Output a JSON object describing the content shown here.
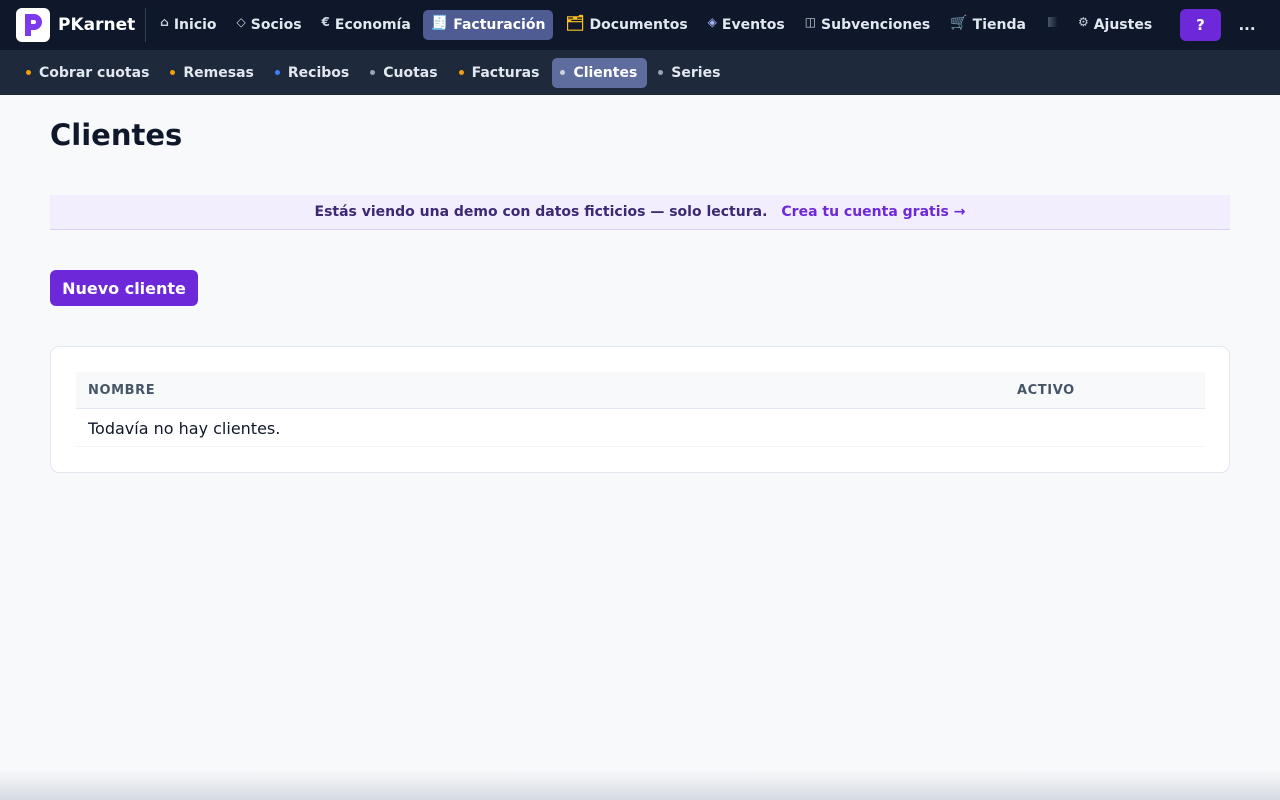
{
  "app": {
    "brand": "PKarnet",
    "logo_letter": "P",
    "accent_color": "#6d28d9"
  },
  "topnav": {
    "items": [
      {
        "label": "Inicio",
        "icon": "home-icon",
        "glyph": "⌂",
        "active": false
      },
      {
        "label": "Socios",
        "icon": "diamond-outline-icon",
        "glyph": "◇",
        "active": false
      },
      {
        "label": "Economía",
        "icon": "euro-icon",
        "glyph": "€",
        "active": false
      },
      {
        "label": "Facturación",
        "icon": "receipt-icon",
        "glyph": "🧾",
        "active": true
      },
      {
        "label": "Documentos",
        "icon": "folder-icon",
        "glyph": "🗂",
        "active": false
      },
      {
        "label": "Eventos",
        "icon": "diamond-icon",
        "glyph": "◈",
        "active": false
      },
      {
        "label": "Subvenciones",
        "icon": "grant-icon",
        "glyph": "◫",
        "active": false
      },
      {
        "label": "Tienda",
        "icon": "cart-icon",
        "glyph": "🛒",
        "active": false
      }
    ],
    "settings": {
      "label": "Ajustes",
      "icon": "gear-icon",
      "glyph": "⚙"
    },
    "help_label": "?",
    "more_label": "..."
  },
  "subnav": {
    "items": [
      {
        "label": "Cobrar cuotas",
        "dot_color": "#f59e0b",
        "active": false
      },
      {
        "label": "Remesas",
        "dot_color": "#f59e0b",
        "active": false
      },
      {
        "label": "Recibos",
        "dot_color": "#3b82f6",
        "active": false
      },
      {
        "label": "Cuotas",
        "dot_color": "#94a3b8",
        "active": false
      },
      {
        "label": "Facturas",
        "dot_color": "#f59e0b",
        "active": false
      },
      {
        "label": "Clientes",
        "dot_color": "#cbd5e1",
        "active": true
      },
      {
        "label": "Series",
        "dot_color": "#94a3b8",
        "active": false
      }
    ]
  },
  "main": {
    "title": "Clientes",
    "demo_banner": {
      "text": "Estás viendo una demo con datos ficticios — solo lectura.",
      "link": "Crea tu cuenta gratis →"
    },
    "new_button": "Nuevo cliente",
    "table": {
      "columns": [
        "NOMBRE",
        "ACTIVO"
      ],
      "empty_message": "Todavía no hay clientes."
    }
  }
}
